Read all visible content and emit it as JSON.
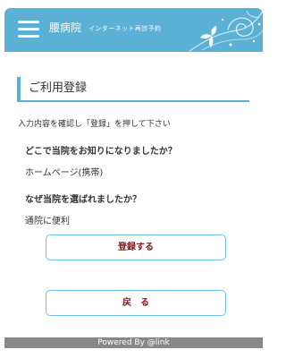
{
  "header": {
    "hospital_name": "腰病院",
    "subtitle": "インターネット再診予約",
    "menu_icon": "hamburger-menu-icon",
    "decoration_icon": "floral-swirl-icon",
    "background_color": "#5bb0d6"
  },
  "section": {
    "title": "ご利用登録"
  },
  "instructions": "入力内容を確認し「登録」を押して下さい",
  "form": {
    "questions": [
      {
        "question": "どこで当院をお知りになりましたか？",
        "answer": "ホームページ(携帯)"
      },
      {
        "question": "なぜ当院を選ばれましたか？",
        "answer": "通院に便利"
      }
    ]
  },
  "buttons": {
    "register_label": "登録する",
    "back_label": "戻る"
  },
  "footer": {
    "text": "Powered By @link",
    "background_color": "#888888"
  },
  "colors": {
    "accent": "#5bb0d6",
    "button_border": "#6ec1ea",
    "button_text": "#7a1b1b"
  }
}
